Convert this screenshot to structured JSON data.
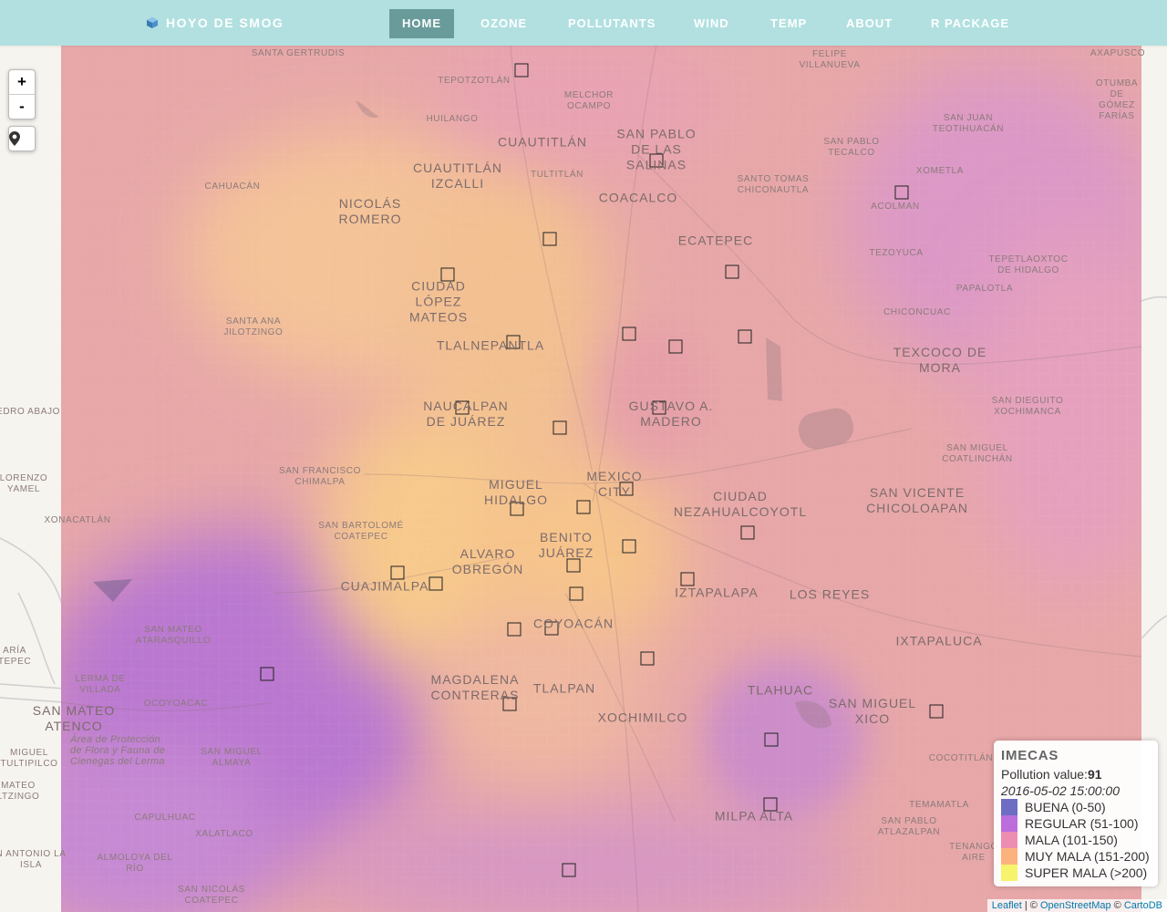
{
  "navbar": {
    "brand": "HOYO DE SMOG",
    "items": [
      {
        "label": "HOME",
        "active": true
      },
      {
        "label": "OZONE",
        "active": false
      },
      {
        "label": "POLLUTANTS",
        "active": false
      },
      {
        "label": "WIND",
        "active": false
      },
      {
        "label": "TEMP",
        "active": false
      },
      {
        "label": "ABOUT",
        "active": false
      },
      {
        "label": "R PACKAGE",
        "active": false
      }
    ],
    "colors": {
      "bar": "#b2e0e0",
      "active": "#6a9b9b",
      "text": "#ffffff"
    }
  },
  "controls": {
    "zoom_in": "+",
    "zoom_out": "-",
    "locate_icon": "map-marker-icon"
  },
  "legend": {
    "title": "IMECAS",
    "pollution_label": "Pollution value:",
    "pollution_value": "91",
    "datetime": "2016-05-02 15:00:00",
    "categories": [
      {
        "label": "BUENA (0-50)",
        "color": "#3b3db0"
      },
      {
        "label": "REGULAR (51-100)",
        "color": "#a63ed1"
      },
      {
        "label": "MALA (101-150)",
        "color": "#e8689a"
      },
      {
        "label": "MUY MALA (151-200)",
        "color": "#fb9a55"
      },
      {
        "label": "SUPER MALA (>200)",
        "color": "#f3f03c"
      }
    ]
  },
  "attribution": {
    "leaflet": "Leaflet",
    "sep1": " | © ",
    "osm": "OpenStreetMap",
    "sep2": " © ",
    "carto": "CartoDB"
  },
  "places": [
    {
      "name": "SANTA GERTRUDIS",
      "size": "small"
    },
    {
      "name": "TEPOTZOTLÁN",
      "size": "small"
    },
    {
      "name": "MELCHOR\nOCAMPO",
      "size": "small"
    },
    {
      "name": "FELIPE\nVILLANUEVA",
      "size": "small"
    },
    {
      "name": "AXAPUSCO",
      "size": "small"
    },
    {
      "name": "HUILANGO",
      "size": "small"
    },
    {
      "name": "CUAUTITLÁN",
      "size": "big"
    },
    {
      "name": "SAN PABLO\nDE LAS\nSALINAS",
      "size": "big"
    },
    {
      "name": "OTUMBA DE\nGÓMEZ FARÍAS",
      "size": "small"
    },
    {
      "name": "SAN JUAN\nTEOTIHUACÁN",
      "size": "small"
    },
    {
      "name": "SAN PABLO\nTECALCO",
      "size": "small"
    },
    {
      "name": "CUAUTITLÁN\nIZCALLI",
      "size": "big"
    },
    {
      "name": "TULTITLÁN",
      "size": "small"
    },
    {
      "name": "SANTO TOMAS\nCHICONAUTLA",
      "size": "small"
    },
    {
      "name": "XOMETLA",
      "size": "small"
    },
    {
      "name": "CAHUACÁN",
      "size": "small"
    },
    {
      "name": "NICOLÁS\nROMERO",
      "size": "big"
    },
    {
      "name": "COACALCO",
      "size": "big"
    },
    {
      "name": "ACOLMAN",
      "size": "small"
    },
    {
      "name": "ECATEPEC",
      "size": "big"
    },
    {
      "name": "TEZOYUCA",
      "size": "small"
    },
    {
      "name": "TEPETLAOXTOC\nDE HIDALGO",
      "size": "small"
    },
    {
      "name": "PAPALOTLA",
      "size": "small"
    },
    {
      "name": "CIUDAD\nLÓPEZ\nMATEOS",
      "size": "big"
    },
    {
      "name": "CHICONCUAC",
      "size": "small"
    },
    {
      "name": "SANTA ANA\nJILOTZINGO",
      "size": "small"
    },
    {
      "name": "TLALNEPANTLA",
      "size": "big"
    },
    {
      "name": "TEXCOCO DE\nMORA",
      "size": "big"
    },
    {
      "name": "NAUCALPAN\nDE JUÁREZ",
      "size": "big"
    },
    {
      "name": "GUSTAVO A.\nMADERO",
      "size": "big"
    },
    {
      "name": "SAN DIEGUITO\nXOCHIMANCA",
      "size": "small"
    },
    {
      "name": "EDRO ABAJO",
      "size": "small"
    },
    {
      "name": "SAN MIGUEL\nCOATLINCHÁN",
      "size": "small"
    },
    {
      "name": "MEXICO\nCITY",
      "size": "big"
    },
    {
      "name": "SAN FRANCISCO\nCHIMALPA",
      "size": "small"
    },
    {
      "name": "LORENZO\nYAMEL",
      "size": "small"
    },
    {
      "name": "MIGUEL\nHIDALGO",
      "size": "big"
    },
    {
      "name": "CIUDAD\nNEZAHUALCOYOTL",
      "size": "big"
    },
    {
      "name": "SAN VICENTE\nCHICOLOAPAN",
      "size": "big"
    },
    {
      "name": "XONACATLÁN",
      "size": "small"
    },
    {
      "name": "SAN BARTOLOMÉ\nCOATEPEC",
      "size": "small"
    },
    {
      "name": "BENITO\nJUÁREZ",
      "size": "big"
    },
    {
      "name": "ALVARO\nOBREGÓN",
      "size": "big"
    },
    {
      "name": "CUAJIMALPA",
      "size": "big"
    },
    {
      "name": "IZTAPALAPA",
      "size": "big"
    },
    {
      "name": "LOS REYES",
      "size": "big"
    },
    {
      "name": "COYOACÁN",
      "size": "big"
    },
    {
      "name": "SAN MATEO\nATARASQUILLO",
      "size": "small"
    },
    {
      "name": "IXTAPALUCA",
      "size": "big"
    },
    {
      "name": "LERMA DE\nVILLADA",
      "size": "small"
    },
    {
      "name": "MAGDALENA\nCONTRERAS",
      "size": "big"
    },
    {
      "name": "TLALPAN",
      "size": "big"
    },
    {
      "name": "TLAHUAC",
      "size": "big"
    },
    {
      "name": "SAN MIGUEL\nXICO",
      "size": "big"
    },
    {
      "name": "SAN MATEO\nATENCO",
      "size": "big"
    },
    {
      "name": "OCOYOACAC",
      "size": "small"
    },
    {
      "name": "XOCHIMILCO",
      "size": "big"
    },
    {
      "name": "SAN MIGUEL\nALMAYA",
      "size": "small"
    },
    {
      "name": "COCOTITLÁN",
      "size": "small"
    },
    {
      "name": "SAN PABLO\nATLAZALPAN",
      "size": "small"
    },
    {
      "name": "TEMAMATLA",
      "size": "small"
    },
    {
      "name": "CAPULHUAC",
      "size": "small"
    },
    {
      "name": "MILPA ALTA",
      "size": "big"
    },
    {
      "name": "XALATLACO",
      "size": "small"
    },
    {
      "name": "ALMOLOYA DEL\nRÍO",
      "size": "small"
    },
    {
      "name": "SAN NICOLÁS\nCOATEPEC",
      "size": "small"
    },
    {
      "name": "N ANTONIO LA\nISLA",
      "size": "small"
    },
    {
      "name": "MIGUEL\nTULTIPILCO",
      "size": "small"
    },
    {
      "name": "MATEO\nLTZINGO",
      "size": "small"
    },
    {
      "name": "ARÍA\nTEPEC",
      "size": "small"
    },
    {
      "name": "TENANGO\nAIRE",
      "size": "small"
    },
    {
      "name": "Área de Protección\nde Flora y Fauna de\nCienegas del Lerma",
      "size": "italic"
    }
  ],
  "stations_count": 31
}
